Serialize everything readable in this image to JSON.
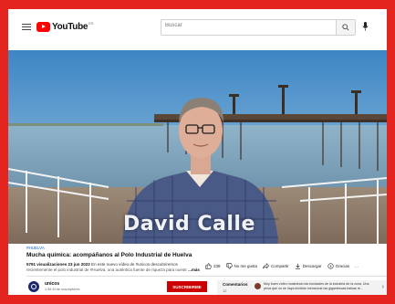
{
  "header": {
    "logo_text": "YouTube",
    "logo_superscript": "ES",
    "search_placeholder": "Buscar"
  },
  "video": {
    "watermark": "David Calle"
  },
  "info": {
    "hashtag": "#HUELVA",
    "title": "Mucha química: acompáñanos al Polo Industrial de Huelva",
    "views": "5791 visualizaciones",
    "date": "23 jun 2022",
    "desc_line1": "En este nuevo vídeo de #unicos descubriremos",
    "desc_line2": "recientemente el polo industrial de #Huelva, una auténtica fuente de riqueza para nuestr",
    "more": "...más"
  },
  "actions": {
    "likes": "238",
    "dislike": "No me gusta",
    "share": "Compartir",
    "download": "Descargar",
    "thanks": "Gracias",
    "more": "..."
  },
  "channel": {
    "name": "unicos",
    "subs": "1,96 M de suscriptores",
    "subscribe_label": "SUSCRIBIRME"
  },
  "comments": {
    "title": "Comentarios",
    "count": "12",
    "preview": "Muy buen vídeo mostrando las bondades de la industria de la zona. Una pena que no se haya incidido mencionar las gigantescas balsas re..."
  },
  "colors": {
    "page_border": "#e3241f",
    "brand_red": "#ff0000",
    "subscribe": "#cc0000",
    "link": "#065fd4"
  }
}
